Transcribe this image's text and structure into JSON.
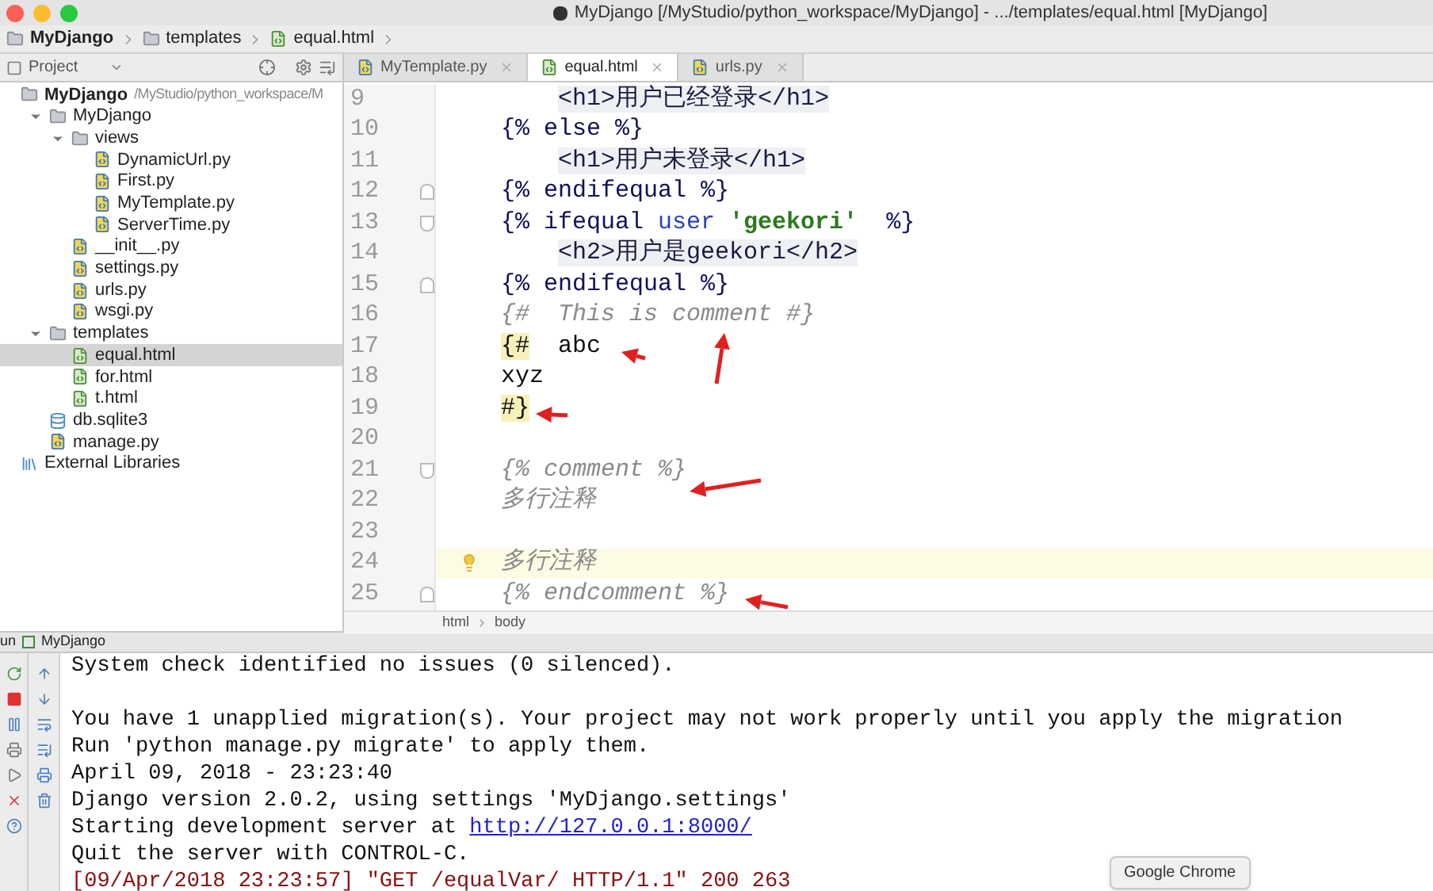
{
  "window": {
    "title": "MyDjango [/MyStudio/python_workspace/MyDjango] - .../templates/equal.html [MyDjango]"
  },
  "breadcrumb": [
    {
      "label": "MyDjango",
      "kind": "folder"
    },
    {
      "label": "templates",
      "kind": "folder"
    },
    {
      "label": "equal.html",
      "kind": "html"
    }
  ],
  "project": {
    "title": "Project",
    "tree": [
      {
        "name": "MyDjango",
        "path": "/MyStudio/python_workspace/M",
        "kind": "folder",
        "selected": false,
        "children": [
          {
            "name": "MyDjango",
            "kind": "folder",
            "expanded": true,
            "selected": false,
            "children": [
              {
                "name": "views",
                "kind": "folder",
                "expanded": true,
                "selected": false,
                "children": [
                  {
                    "name": "DynamicUrl.py",
                    "kind": "py",
                    "selected": false
                  },
                  {
                    "name": "First.py",
                    "kind": "py",
                    "selected": false
                  },
                  {
                    "name": "MyTemplate.py",
                    "kind": "py",
                    "selected": false
                  },
                  {
                    "name": "ServerTime.py",
                    "kind": "py",
                    "selected": false
                  }
                ]
              },
              {
                "name": "__init__.py",
                "kind": "py",
                "selected": false
              },
              {
                "name": "settings.py",
                "kind": "py",
                "selected": false
              },
              {
                "name": "urls.py",
                "kind": "py",
                "selected": false
              },
              {
                "name": "wsgi.py",
                "kind": "py",
                "selected": false
              }
            ]
          },
          {
            "name": "templates",
            "kind": "folder",
            "expanded": true,
            "selected": false,
            "children": [
              {
                "name": "equal.html",
                "kind": "html",
                "selected": true
              },
              {
                "name": "for.html",
                "kind": "html",
                "selected": false
              },
              {
                "name": "t.html",
                "kind": "html",
                "selected": false
              }
            ]
          },
          {
            "name": "db.sqlite3",
            "kind": "db",
            "selected": false
          },
          {
            "name": "manage.py",
            "kind": "py",
            "selected": false
          }
        ]
      },
      {
        "name": "External Libraries",
        "kind": "libraries",
        "selected": false
      }
    ]
  },
  "tabs": [
    {
      "label": "MyTemplate.py",
      "kind": "py",
      "selected": false
    },
    {
      "label": "equal.html",
      "kind": "html",
      "selected": true
    },
    {
      "label": "urls.py",
      "kind": "py",
      "selected": false
    }
  ],
  "editor": {
    "lines": [
      {
        "number": "9",
        "current": false,
        "indent": true,
        "segments": [
          {
            "text": "<h1>用户已经登录</h1>",
            "kind": "tag"
          }
        ]
      },
      {
        "number": "10",
        "current": false,
        "segments": [
          {
            "text": "{% else %}",
            "kind": "keyword"
          }
        ]
      },
      {
        "number": "11",
        "current": false,
        "indent": true,
        "segments": [
          {
            "text": "<h1>用户未登录</h1>",
            "kind": "tag"
          }
        ]
      },
      {
        "number": "12",
        "current": false,
        "fold_opens": false,
        "segments": [
          {
            "text": "{% endifequal %}",
            "kind": "keyword"
          }
        ]
      },
      {
        "number": "13",
        "current": false,
        "fold_opens": true,
        "segments": [
          {
            "text": "{% ifequal ",
            "kind": "keyword"
          },
          {
            "text": "user ",
            "kind": "var"
          },
          {
            "text": "'geekori'",
            "kind": "string"
          },
          {
            "text": "  %}",
            "kind": "keyword"
          }
        ]
      },
      {
        "number": "14",
        "current": false,
        "indent": true,
        "segments": [
          {
            "text": "<h2>用户是geekori</h2>",
            "kind": "tag"
          }
        ]
      },
      {
        "number": "15",
        "current": false,
        "fold_opens": false,
        "segments": [
          {
            "text": "{% endifequal %}",
            "kind": "keyword"
          }
        ]
      },
      {
        "number": "16",
        "current": false,
        "segments": [
          {
            "text": "{#  This is comment #}",
            "kind": "comment"
          }
        ]
      },
      {
        "number": "17",
        "current": false,
        "segments": [
          {
            "text": "{#",
            "kind": "match"
          },
          {
            "text": "  abc",
            "kind": "plain"
          }
        ]
      },
      {
        "number": "18",
        "current": false,
        "segments": [
          {
            "text": "xyz",
            "kind": "plain"
          }
        ]
      },
      {
        "number": "19",
        "current": false,
        "segments": [
          {
            "text": "#}",
            "kind": "match"
          }
        ]
      },
      {
        "number": "20",
        "current": false
      },
      {
        "number": "21",
        "current": false,
        "fold_opens": true,
        "segments": [
          {
            "text": "{% comment %}",
            "kind": "comment"
          }
        ]
      },
      {
        "number": "22",
        "current": false,
        "segments": [
          {
            "text": "多行注释",
            "kind": "comment"
          }
        ]
      },
      {
        "number": "23",
        "current": false
      },
      {
        "number": "24",
        "current": true,
        "segments": [
          {
            "text": "多行注释",
            "kind": "comment"
          }
        ]
      },
      {
        "number": "25",
        "current": false,
        "fold_opens": false,
        "segments": [
          {
            "text": "{% endcomment %}",
            "kind": "comment"
          }
        ]
      }
    ],
    "path": [
      "html",
      "body"
    ]
  },
  "run": {
    "label": "un",
    "config": "MyDjango",
    "lines": [
      {
        "space_after": true,
        "segments": [
          {
            "text": "System check identified no issues (0 silenced).",
            "kind": "plain"
          }
        ]
      },
      {
        "segments": [
          {
            "text": "You have 1 unapplied migration(s). Your project may not work properly until you apply the migration",
            "kind": "plain"
          }
        ]
      },
      {
        "segments": [
          {
            "text": "Run 'python manage.py migrate' to apply them.",
            "kind": "plain"
          }
        ]
      },
      {
        "segments": [
          {
            "text": "April 09, 2018 - 23:23:40",
            "kind": "plain"
          }
        ]
      },
      {
        "segments": [
          {
            "text": "Django version 2.0.2, using settings 'MyDjango.settings'",
            "kind": "plain"
          }
        ]
      },
      {
        "segments": [
          {
            "text": "Starting development server at ",
            "kind": "plain"
          },
          {
            "text": "http://127.0.0.1:8000/",
            "kind": "link"
          }
        ]
      },
      {
        "segments": [
          {
            "text": "Quit the server with CONTROL-C.",
            "kind": "plain"
          }
        ]
      },
      {
        "segments": [
          {
            "text": "[09/Apr/2018 23:23:57] \"GET /equalVar/ HTTP/1.1\" 200 263",
            "kind": "error"
          }
        ]
      }
    ]
  },
  "tooltip": {
    "text": "Google Chrome"
  }
}
